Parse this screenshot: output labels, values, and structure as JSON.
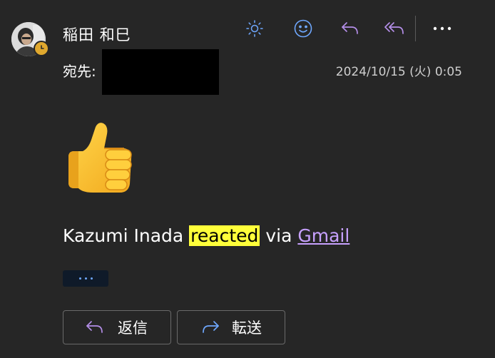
{
  "message": {
    "sender": "稲田 和巳",
    "to_label": "宛先:",
    "date": "2024/10/15 (火) 0:05",
    "reaction_emoji": "thumbs-up",
    "reaction_name": "Kazumi Inada",
    "reaction_verb": "reacted",
    "reaction_via": "via",
    "reaction_link": "Gmail"
  },
  "toolbar": {
    "icons": [
      "sun-icon",
      "smiley-icon",
      "reply-icon",
      "reply-all-icon",
      "more-icon"
    ]
  },
  "actions": {
    "reply_label": "返信",
    "forward_label": "転送"
  },
  "colors": {
    "background": "#262626",
    "accent_blue": "#6fa8ff",
    "accent_purple": "#b48ee8",
    "highlight": "#ffff3a",
    "link": "#c7a1ff",
    "status_badge": "#e0a82e"
  }
}
